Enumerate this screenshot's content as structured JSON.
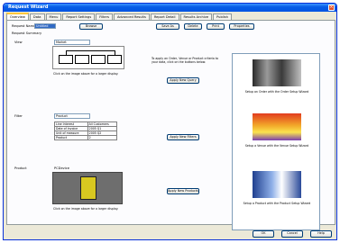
{
  "window": {
    "title": "Request Wizard",
    "close_glyph": "×"
  },
  "tabs": [
    "Overview",
    "Data",
    "Menu",
    "Report Settings",
    "Filters",
    "Advanced Results",
    "Report Detail",
    "Results Archive",
    "Publish"
  ],
  "request": {
    "name_label": "Request Name",
    "name_value": "Untitled",
    "browse_btn": "Browse"
  },
  "toolbar": [
    "Save As",
    "Delete",
    "Print",
    "Properties"
  ],
  "summary_label": "Request Summary",
  "sections": {
    "view": {
      "label": "View",
      "value": "Market",
      "hint": "Click on the image above for a larger display.",
      "button": "Apply New Query"
    },
    "filter": {
      "label": "Filter",
      "value": "Product",
      "rows": [
        [
          "Line Interest",
          "All Customers"
        ],
        [
          "Date of Invoice",
          "2005 Q1"
        ],
        [
          "Unit of measure",
          "2005 Q2"
        ],
        [
          "Product",
          "2"
        ]
      ],
      "button": "Apply New Filters"
    },
    "product": {
      "label": "Product",
      "value": "PCDevice",
      "hint": "Click on the image above for a larger display.",
      "button": "Apply New Products"
    }
  },
  "instructions": "To apply an Order, Venue or Product criteria to your data, click on the buttons below.",
  "right_items": [
    "Setup an Order with the Order Setup Wizard",
    "Setup a Venue with the Venue Setup Wizard",
    "Setup a Product with the Product Setup Wizard"
  ],
  "footer_buttons": [
    "OK",
    "Cancel",
    "Help"
  ]
}
